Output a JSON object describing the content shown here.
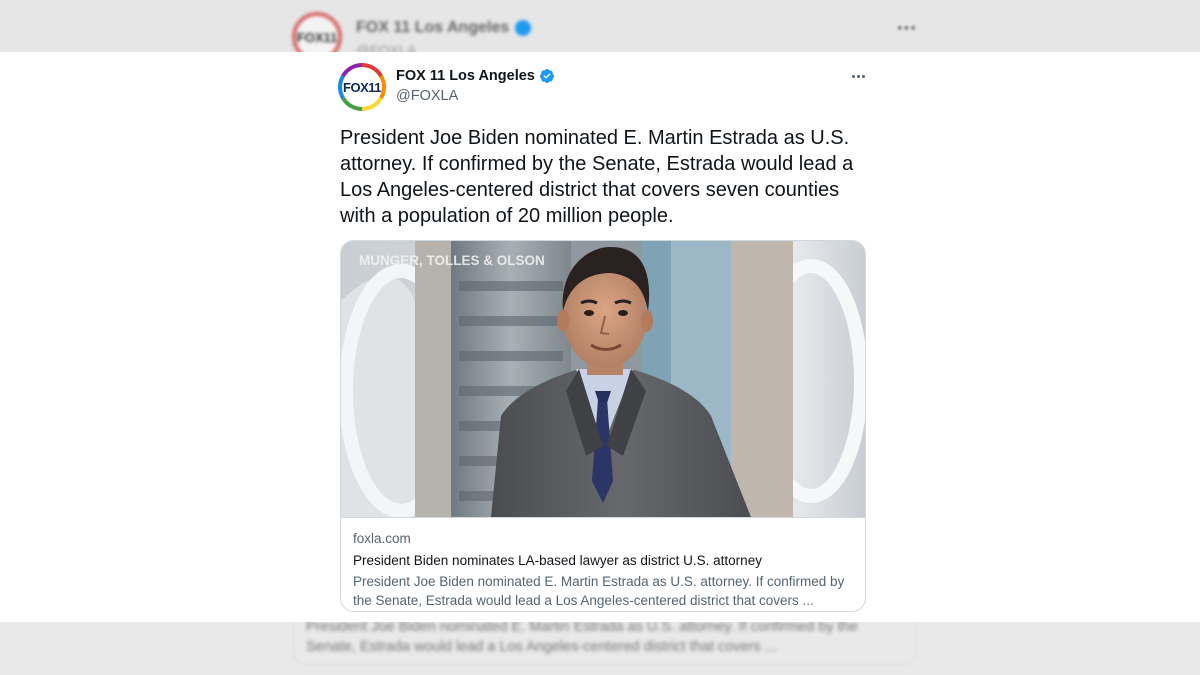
{
  "background_tweet": {
    "display_name": "FOX 11 Los Angeles",
    "handle": "@FOXLA",
    "logo_text": "FOX11",
    "more_label": "•••",
    "blurred_text": "President Joe Biden nominated E. Martin Estrada as U.S. attorney. If confirmed by the Senate, Estrada would lead a Los Angeles-centered district that covers ..."
  },
  "tweet": {
    "avatar_text": "FOX11",
    "display_name": "FOX 11 Los Angeles",
    "handle": "@FOXLA",
    "verified": true,
    "text": "President Joe Biden nominated E. Martin Estrada as U.S. attorney. If confirmed by the Senate, Estrada would lead a Los Angeles-centered district that covers seven counties with a population of 20 million people."
  },
  "card": {
    "image_watermark": "MUNGER, TOLLES & OLSON",
    "domain": "foxla.com",
    "title": "President Biden nominates LA-based lawyer as district U.S. attorney",
    "description": "President Joe Biden nominated E. Martin Estrada as U.S. attorney. If confirmed by the Senate, Estrada would lead a Los Angeles-centered district that covers ..."
  },
  "colors": {
    "verified_badge": "#1d9bf0",
    "text_primary": "#0f1419",
    "text_secondary": "#536471",
    "card_border": "#cfd9de"
  },
  "icons": [
    "verified-badge-icon",
    "more-options-icon"
  ]
}
